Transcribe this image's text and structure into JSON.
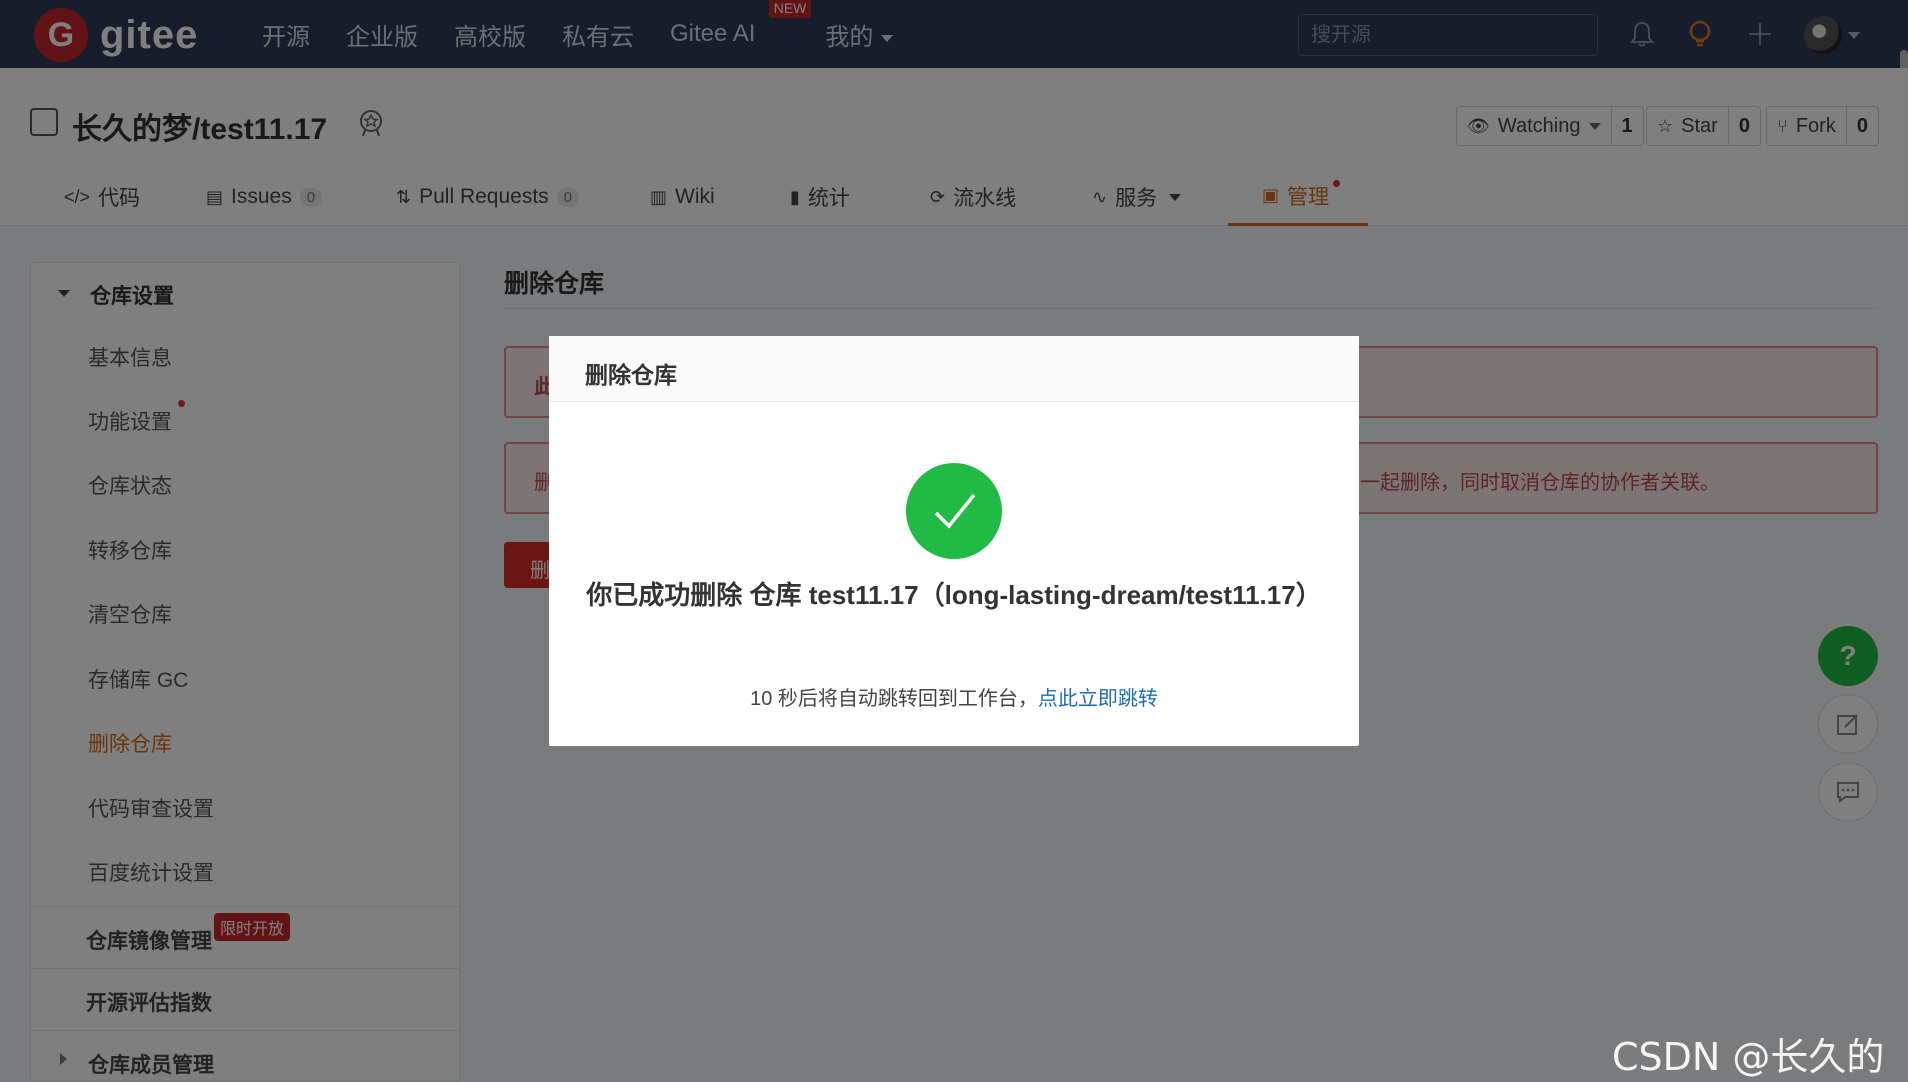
{
  "nav": {
    "logo_text": "gitee",
    "logo_letter": "G",
    "links": [
      "开源",
      "企业版",
      "高校版",
      "私有云",
      "Gitee AI",
      "我的"
    ],
    "new_badge": "NEW",
    "search_placeholder": "搜开源"
  },
  "repo": {
    "title": "长久的梦/test11.17",
    "watching_label": "Watching",
    "watching_count": "1",
    "star_label": "Star",
    "star_count": "0",
    "fork_label": "Fork",
    "fork_count": "0"
  },
  "tabs": [
    {
      "label": "代码"
    },
    {
      "label": "Issues",
      "count": "0"
    },
    {
      "label": "Pull Requests",
      "count": "0"
    },
    {
      "label": "Wiki"
    },
    {
      "label": "统计"
    },
    {
      "label": "流水线"
    },
    {
      "label": "服务"
    },
    {
      "label": "管理"
    }
  ],
  "sidebar": {
    "group_title": "仓库设置",
    "items": [
      "基本信息",
      "功能设置",
      "仓库状态",
      "转移仓库",
      "清空仓库",
      "存储库 GC",
      "删除仓库",
      "代码审查设置",
      "百度统计设置"
    ],
    "active_item": "删除仓库",
    "sections": [
      "仓库镜像管理",
      "开源评估指数",
      "仓库成员管理"
    ],
    "limited_badge": "限时开放"
  },
  "main": {
    "title": "删除仓库",
    "alert1_text": "此",
    "alert2_left": "删",
    "alert2_right": "一起删除，同时取消仓库的协作者关联。",
    "delete_button_label": "删"
  },
  "modal": {
    "title": "删除仓库",
    "message": "你已成功删除 仓库 test11.17（long-lasting-dream/test11.17）",
    "sub_prefix": "10 秒后将自动跳转回到工作台，",
    "sub_link": "点此立即跳转"
  },
  "fab": {
    "help": "?"
  },
  "watermark": "CSDN @长久的梦",
  "colors": {
    "nav_bg": "#2f3a56",
    "brand_red": "#c7262a",
    "accent_orange": "#d4691c",
    "success_green": "#21ba45",
    "link_blue": "#1e6bb8"
  }
}
